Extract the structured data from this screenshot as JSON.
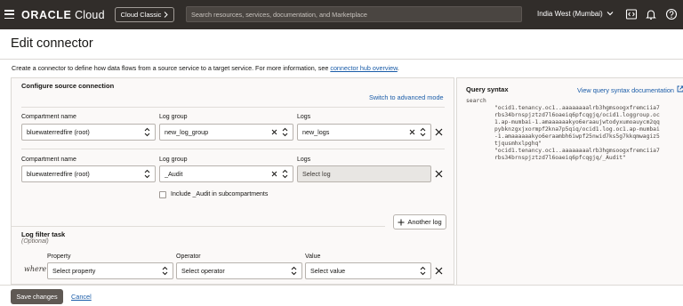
{
  "topbar": {
    "brand_oracle": "ORACLE",
    "brand_cloud": "Cloud",
    "classic_label": "Cloud Classic",
    "search_placeholder": "Search resources, services, documentation, and Marketplace",
    "region": "India West (Mumbai)"
  },
  "page": {
    "title": "Edit connector",
    "intro": "Create a connector to define how data flows from a source service to a target service. For more information, see ",
    "intro_link": "connector hub overview",
    "intro_end": "."
  },
  "source": {
    "section_title": "Configure source connection",
    "advanced_link": "Switch to advanced mode",
    "labels": {
      "compartment": "Compartment name",
      "log_group": "Log group",
      "logs": "Logs"
    },
    "rows": [
      {
        "compartment": "bluewaterredfire (root)",
        "log_group": "new_log_group",
        "logs": "new_logs"
      },
      {
        "compartment": "bluewaterredfire (root)",
        "log_group": "_Audit",
        "logs": "Select log"
      }
    ],
    "include_audit_label": "Include _Audit in subcompartments",
    "another_log_label": "Another log"
  },
  "filter": {
    "title": "Log filter task",
    "optional": "(Optional)",
    "headers": {
      "property": "Property",
      "operator": "Operator",
      "value": "Value"
    },
    "where": "where",
    "property_placeholder": "Select property",
    "operator_placeholder": "Select operator",
    "value_placeholder": "Select value"
  },
  "query": {
    "title": "Query syntax",
    "doc_link": "View query syntax documentation",
    "lines": [
      "search",
      "\"ocid1.tenancy.oc1..aaaaaaaalrb3hgmsoogxfremciia7",
      "rbs34brnspjztzd7l6oaeiq6pfcqgjq/ocid1.loggroup.oc",
      "1.ap-mumbai-1.amaaaaaakyo6eraaujwtodyxumoauycm2qq",
      "pybknzgxjxormpf2kna7p5qiq/ocid1.log.oc1.ap-mumbai",
      "-1.amaaaaaakyo6eraambh6iwpf25nwid7ks5g7kkqmwagiz5",
      "tjqusmhxlpghq\"",
      "\"ocid1.tenancy.oc1..aaaaaaaalrb3hgmsoogxfremciia7",
      "rbs34brnspjztzd7l6oaeiq6pfcqgjq/_Audit\""
    ]
  },
  "footer": {
    "save_label": "Save changes",
    "cancel_label": "Cancel"
  }
}
